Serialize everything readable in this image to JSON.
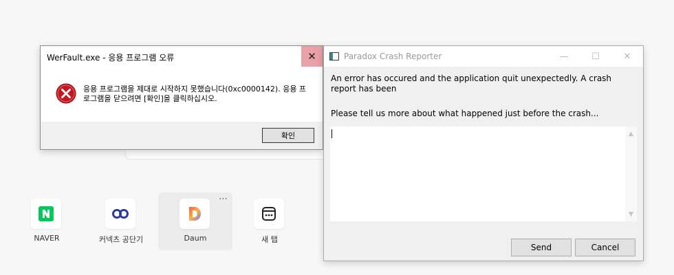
{
  "werfault": {
    "title": "WerFault.exe - 응용 프로그램 오류",
    "close_glyph": "✕",
    "icon": "error-icon",
    "message": "응용 프로그램을 제대로 시작하지 못했습니다(0xc0000142). 응용 프로그램을 닫으려면 [확인]을 클릭하십시오.",
    "ok_label": "확인"
  },
  "crash_reporter": {
    "title": "Paradox Crash Reporter",
    "minimize_glyph": "—",
    "maximize_glyph": "☐",
    "close_glyph": "✕",
    "message": "An error has occured and the application quit unexpectedly. A crash report has been",
    "prompt": "Please tell us more about what happened just before the crash...",
    "textarea_value": "",
    "send_label": "Send",
    "cancel_label": "Cancel"
  },
  "shortcuts": [
    {
      "label": "NAVER",
      "icon": "naver-icon",
      "color": "#03c75a"
    },
    {
      "label": "커넥츠 공단기",
      "icon": "connects-icon",
      "color": "#2b3a9e"
    },
    {
      "label": "Daum",
      "icon": "daum-icon",
      "color": "#ff5a4a"
    },
    {
      "label": "새 탭",
      "icon": "new-tab-icon",
      "color": "#222222"
    }
  ],
  "shortcut_more": "⋯"
}
